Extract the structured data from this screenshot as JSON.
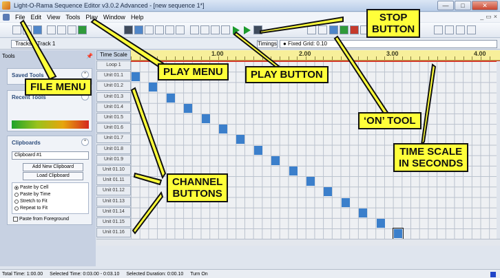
{
  "window": {
    "title": "Light-O-Rama Sequence Editor v3.0.2 Advanced - [new sequence 1*]",
    "window_buttons": [
      "—",
      "□",
      "✕"
    ]
  },
  "menu": {
    "items": [
      "File",
      "Edit",
      "View",
      "Tools",
      "Play",
      "Window",
      "Help"
    ],
    "mdi_buttons": [
      "_",
      "▭",
      "×"
    ]
  },
  "trackrow": {
    "track_button": "Tracks",
    "track_label": "Track 1",
    "timings_button": "Timings",
    "timings_value": "● Fixed Grid: 0.10"
  },
  "left_panel": {
    "header": "Tools",
    "saved_tools_title": "Saved Tools",
    "recent_tools_title": "Recent Tools",
    "clipboards_title": "Clipboards",
    "clipboard_select": "Clipboard #1",
    "add_clipboard": "Add New Clipboard",
    "load_clipboard": "Load Clipboard",
    "paste_options": [
      "Paste by Cell",
      "Paste by Time",
      "Stretch to Fit",
      "Repeat to Fit"
    ],
    "paste_selected": 0,
    "paste_from_foreground": "Paste from Foreground"
  },
  "grid": {
    "time_scale_header": "Time Scale",
    "loop_label": "Loop 1",
    "channels": [
      "Unit 01.1",
      "Unit 01.2",
      "Unit 01.3",
      "Unit 01.4",
      "Unit 01.5",
      "Unit 01.6",
      "Unit 01.7",
      "Unit 01.8",
      "Unit 01.9",
      "Unit 01.10",
      "Unit 01.11",
      "Unit 01.12",
      "Unit 01.13",
      "Unit 01.14",
      "Unit 01.15",
      "Unit 01.16"
    ],
    "time_labels": [
      "1.00",
      "2.00",
      "3.00",
      "4.00"
    ],
    "seconds_per_cell": 0.1,
    "on_cells_start_seconds": [
      0.0,
      0.2,
      0.4,
      0.6,
      0.8,
      1.0,
      1.2,
      1.4,
      1.6,
      1.8,
      2.0,
      2.2,
      2.4,
      2.6,
      2.8,
      3.0
    ],
    "on_color": "#3b7fcb",
    "loop_line_color": "#d33b2c"
  },
  "status": {
    "total_time": "Total Time: 1:00.00",
    "selected_time": "Selected Time: 0:03.00 - 0:03.10",
    "selected_duration": "Selected Duration: 0:00.10",
    "mode": "Turn On"
  },
  "callouts": {
    "file_menu": "FILE MENU",
    "play_menu": "PLAY MENU",
    "play_button": "PLAY BUTTON",
    "stop_button": "STOP\nBUTTON",
    "on_tool": "‘ON’ TOOL",
    "time_scale": "TIME SCALE\nIN SECONDS",
    "channel_buttons": "CHANNEL\nBUTTONS",
    "callout_color": "#ffff3a"
  }
}
